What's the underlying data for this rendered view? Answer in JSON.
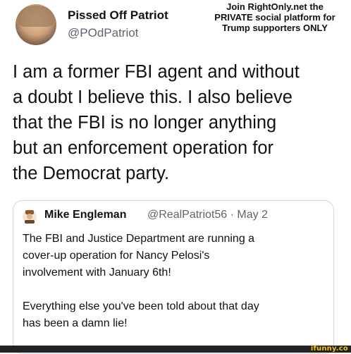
{
  "profile": {
    "display_name": "Pissed Off Patriot",
    "handle": "@POdPatriot"
  },
  "promo": {
    "line1": "Join RightOnly.net the",
    "line2": "PRIVATE social platform for",
    "line3": "Trump supporters ONLY"
  },
  "tweet": {
    "lines": [
      "I am a former FBI agent and without",
      "a doubt I believe this. I also believe",
      "that the FBI is no longer anything",
      "but an enforcement operation for",
      "the Democrat party."
    ]
  },
  "quote": {
    "name": "Mike Engleman",
    "handle_date": "@RealPatriot56 · May 2",
    "lines": [
      "The FBI and Justice Department are running a",
      "cover-up operation for Nancy Pelosi's",
      "involvement with January 6th!",
      "Everything else you've been told about that day",
      "has been a damn lie!"
    ]
  },
  "watermark": "ifunny.co"
}
